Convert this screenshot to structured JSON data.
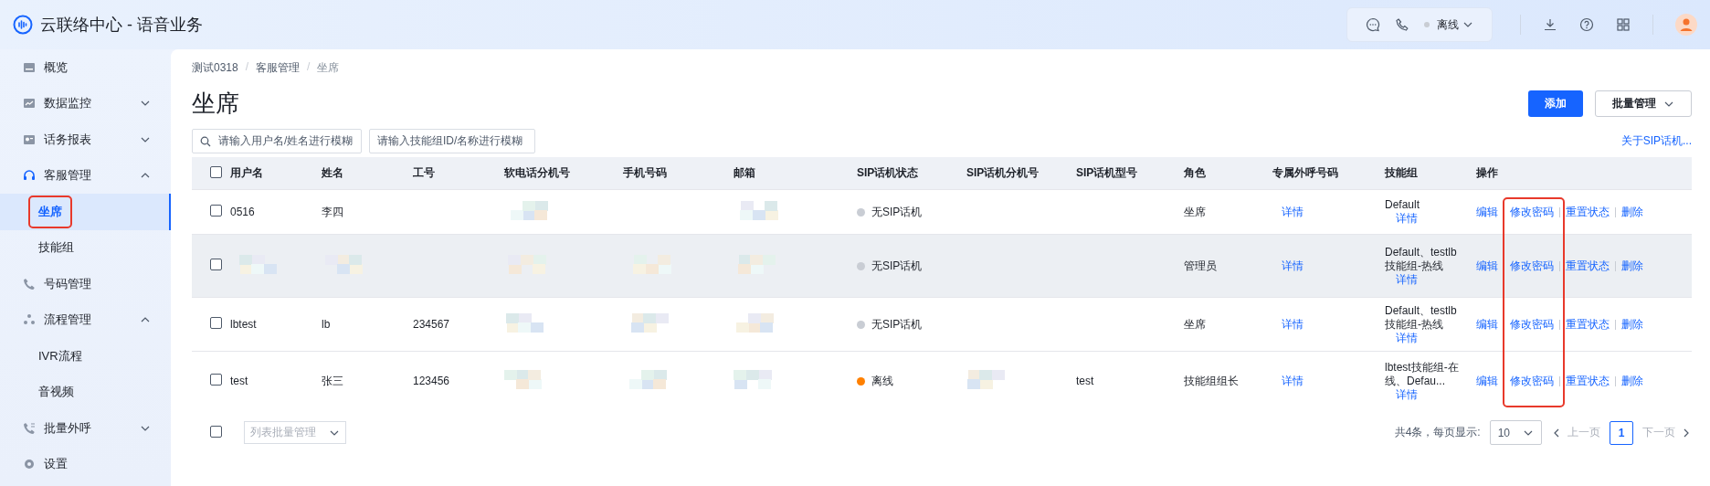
{
  "app": {
    "title": "云联络中心 - 语音业务",
    "status": {
      "text": "离线",
      "color": "#c9cdd4"
    }
  },
  "sidebar": {
    "items": [
      {
        "label": "概览",
        "selected": false,
        "highlighted": false
      },
      {
        "label": "数据监控",
        "selected": false,
        "highlighted": false,
        "expanded": false
      },
      {
        "label": "话务报表",
        "selected": false,
        "highlighted": false,
        "expanded": false
      },
      {
        "label": "客服管理",
        "selected": false,
        "highlighted": false,
        "expanded": true,
        "children": [
          {
            "label": "坐席",
            "selected": true,
            "highlighted": true
          },
          {
            "label": "技能组",
            "selected": false,
            "highlighted": false
          }
        ]
      },
      {
        "label": "号码管理",
        "selected": false,
        "highlighted": false
      },
      {
        "label": "流程管理",
        "selected": false,
        "highlighted": false,
        "expanded": true,
        "children": [
          {
            "label": "IVR流程",
            "selected": false,
            "highlighted": false
          },
          {
            "label": "音视频",
            "selected": false,
            "highlighted": false
          }
        ]
      },
      {
        "label": "批量外呼",
        "selected": false,
        "highlighted": false,
        "expanded": false
      },
      {
        "label": "设置",
        "selected": false,
        "highlighted": false
      }
    ]
  },
  "breadcrumb": {
    "separator": "/",
    "items": [
      "测试0318",
      "客服管理",
      "坐席"
    ]
  },
  "page_title": "坐席",
  "buttons": {
    "add": "添加",
    "batch": "批量管理"
  },
  "filters": {
    "search_placeholder": "请输入用户名/姓名进行模糊",
    "skill_placeholder": "请输入技能组ID/名称进行模糊"
  },
  "about_link": "关于SIP话机...",
  "table": {
    "columns": [
      "用户名",
      "姓名",
      "工号",
      "软电话分机号",
      "手机号码",
      "邮箱",
      "SIP话机状态",
      "SIP话机分机号",
      "SIP话机型号",
      "角色",
      "专属外呼号码",
      "技能组",
      "操作"
    ],
    "header_checked": false,
    "rows": [
      {
        "checked": false,
        "hovered": false,
        "cells": [
          {
            "kind": "text",
            "text": "0516"
          },
          {
            "kind": "text",
            "text": "李四"
          },
          {
            "kind": "blank"
          },
          {
            "kind": "redacted"
          },
          {
            "kind": "blank"
          },
          {
            "kind": "redacted"
          },
          {
            "kind": "status",
            "text": "无SIP话机",
            "color": "#c9cdd4"
          },
          {
            "kind": "blank"
          },
          {
            "kind": "blank"
          },
          {
            "kind": "text",
            "text": "坐席"
          },
          {
            "kind": "link",
            "text": "详情"
          },
          {
            "kind": "skills",
            "text": "Default",
            "link": "详情"
          },
          {
            "kind": "actions",
            "actions": [
              {
                "label": "编辑",
                "highlighted": false
              },
              {
                "label": "修改密码",
                "highlighted": true
              },
              {
                "label": "重置状态",
                "highlighted": false
              },
              {
                "label": "删除",
                "highlighted": false
              }
            ]
          }
        ]
      },
      {
        "checked": false,
        "hovered": true,
        "cells": [
          {
            "kind": "redacted"
          },
          {
            "kind": "redacted"
          },
          {
            "kind": "blank"
          },
          {
            "kind": "redacted"
          },
          {
            "kind": "redacted"
          },
          {
            "kind": "redacted"
          },
          {
            "kind": "status",
            "text": "无SIP话机",
            "color": "#c9cdd4"
          },
          {
            "kind": "blank"
          },
          {
            "kind": "blank"
          },
          {
            "kind": "text",
            "text": "管理员"
          },
          {
            "kind": "link",
            "text": "详情"
          },
          {
            "kind": "skills",
            "text": "Default、testlb技能组-热线",
            "link": "详情"
          },
          {
            "kind": "actions",
            "actions": [
              {
                "label": "编辑",
                "highlighted": false
              },
              {
                "label": "修改密码",
                "highlighted": true
              },
              {
                "label": "重置状态",
                "highlighted": false
              },
              {
                "label": "删除",
                "highlighted": false
              }
            ]
          }
        ]
      },
      {
        "checked": false,
        "hovered": false,
        "cells": [
          {
            "kind": "text",
            "text": "lbtest"
          },
          {
            "kind": "text",
            "text": "lb"
          },
          {
            "kind": "text",
            "text": "234567"
          },
          {
            "kind": "redacted"
          },
          {
            "kind": "redacted"
          },
          {
            "kind": "redacted"
          },
          {
            "kind": "status",
            "text": "无SIP话机",
            "color": "#c9cdd4"
          },
          {
            "kind": "blank"
          },
          {
            "kind": "blank"
          },
          {
            "kind": "text",
            "text": "坐席"
          },
          {
            "kind": "link",
            "text": "详情"
          },
          {
            "kind": "skills",
            "text": "Default、testlb技能组-热线",
            "link": "详情"
          },
          {
            "kind": "actions",
            "actions": [
              {
                "label": "编辑",
                "highlighted": false
              },
              {
                "label": "修改密码",
                "highlighted": true
              },
              {
                "label": "重置状态",
                "highlighted": false
              },
              {
                "label": "删除",
                "highlighted": false
              }
            ]
          }
        ]
      },
      {
        "checked": false,
        "hovered": false,
        "cells": [
          {
            "kind": "text",
            "text": "test"
          },
          {
            "kind": "text",
            "text": "张三"
          },
          {
            "kind": "text",
            "text": "123456"
          },
          {
            "kind": "redacted"
          },
          {
            "kind": "redacted"
          },
          {
            "kind": "redacted"
          },
          {
            "kind": "status",
            "text": "离线",
            "color": "#ff8000"
          },
          {
            "kind": "redacted"
          },
          {
            "kind": "text",
            "text": "test"
          },
          {
            "kind": "text",
            "text": "技能组组长"
          },
          {
            "kind": "link",
            "text": "详情"
          },
          {
            "kind": "skills",
            "text": "lbtest技能组-在线、Defau...",
            "link": "详情"
          },
          {
            "kind": "actions",
            "actions": [
              {
                "label": "编辑",
                "highlighted": false
              },
              {
                "label": "修改密码",
                "highlighted": true
              },
              {
                "label": "重置状态",
                "highlighted": false
              },
              {
                "label": "删除",
                "highlighted": false
              }
            ]
          }
        ]
      }
    ]
  },
  "footer": {
    "checked": false,
    "batch_select": "列表批量管理",
    "total": "共4条，每页显示:",
    "page_size": "10",
    "prev": "上一页",
    "next": "下一页",
    "pages": [
      {
        "label": "1",
        "selected": true
      }
    ]
  }
}
